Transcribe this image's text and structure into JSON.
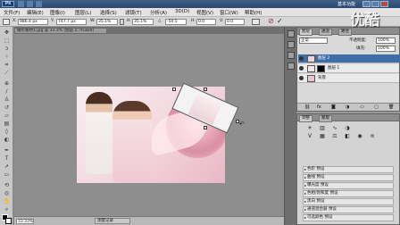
{
  "app": {
    "logo_text": "Ps",
    "workspace_label": "基本功能"
  },
  "menu": [
    "文件(F)",
    "编辑(E)",
    "图像(I)",
    "图层(L)",
    "选择(S)",
    "滤镜(T)",
    "分析(A)",
    "3D(D)",
    "视图(V)",
    "窗口(W)",
    "帮助(H)"
  ],
  "options": {
    "x_label": "X:",
    "x_value": "986.4 px",
    "y_label": "Y:",
    "y_value": "747.7 px",
    "w_label": "W:",
    "w_value": "35.1%",
    "h_label": "H:",
    "h_value": "35.1%",
    "rot_label": "△",
    "rot_value": "-54.5",
    "h_skew_label": "H:",
    "h_skew_value": "0.0",
    "v_skew_label": "V:",
    "v_skew_value": "0.0"
  },
  "document": {
    "tab_label": "婚纱素材1.jpg @ 33.3% (图层 2, RGB/8)"
  },
  "status": {
    "zoom": "33.33%",
    "timeline_label": "测量记录"
  },
  "layers_panel": {
    "tabs": [
      "图层",
      "通道",
      "路径"
    ],
    "blend_mode": "正常",
    "opacity_label": "不透明度:",
    "opacity_value": "100%",
    "fill_label": "填充:",
    "fill_value": "100%",
    "layers": [
      {
        "name": "图层 2",
        "selected": true
      },
      {
        "name": "图层 1",
        "selected": false
      },
      {
        "name": "背景",
        "selected": false
      }
    ]
  },
  "adjustments_panel": {
    "tabs": [
      "调整",
      "蒙版"
    ],
    "presets": [
      "色阶 预设",
      "曲线 预设",
      "曝光度 预设",
      "色相/饱和度 预设",
      "黑白 预设",
      "通道混合器 预设",
      "可选颜色 预设"
    ]
  },
  "watermark": {
    "text": "优酷"
  }
}
